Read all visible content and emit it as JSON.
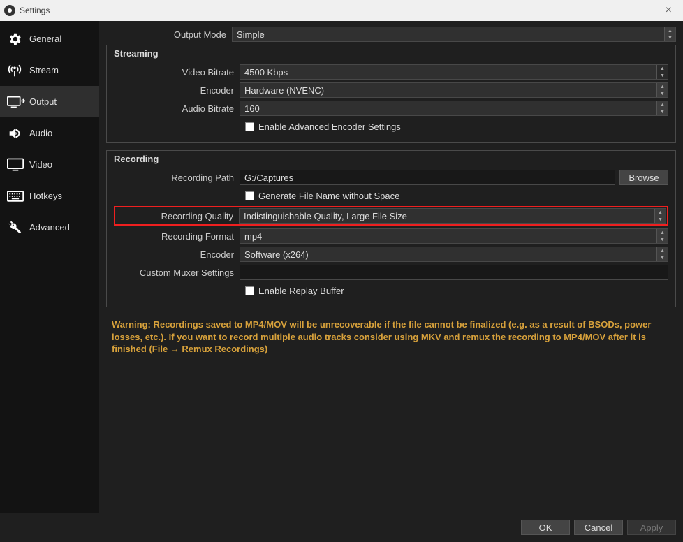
{
  "window": {
    "title": "Settings"
  },
  "sidebar": {
    "items": [
      {
        "label": "General"
      },
      {
        "label": "Stream"
      },
      {
        "label": "Output"
      },
      {
        "label": "Audio"
      },
      {
        "label": "Video"
      },
      {
        "label": "Hotkeys"
      },
      {
        "label": "Advanced"
      }
    ]
  },
  "output_mode": {
    "label": "Output Mode",
    "value": "Simple"
  },
  "streaming": {
    "title": "Streaming",
    "video_bitrate": {
      "label": "Video Bitrate",
      "value": "4500 Kbps"
    },
    "encoder": {
      "label": "Encoder",
      "value": "Hardware (NVENC)"
    },
    "audio_bitrate": {
      "label": "Audio Bitrate",
      "value": "160"
    },
    "adv_cb": {
      "label": "Enable Advanced Encoder Settings"
    }
  },
  "recording": {
    "title": "Recording",
    "path": {
      "label": "Recording Path",
      "value": "G:/Captures",
      "browse": "Browse"
    },
    "gen_cb": {
      "label": "Generate File Name without Space"
    },
    "quality": {
      "label": "Recording Quality",
      "value": "Indistinguishable Quality, Large File Size"
    },
    "format": {
      "label": "Recording Format",
      "value": "mp4"
    },
    "encoder": {
      "label": "Encoder",
      "value": "Software (x264)"
    },
    "muxer": {
      "label": "Custom Muxer Settings",
      "value": ""
    },
    "replay_cb": {
      "label": "Enable Replay Buffer"
    }
  },
  "warning": "Warning: Recordings saved to MP4/MOV will be unrecoverable if the file cannot be finalized (e.g. as a result of BSODs, power losses, etc.). If you want to record multiple audio tracks consider using MKV and remux the recording to MP4/MOV after it is finished (File → Remux Recordings)",
  "footer": {
    "ok": "OK",
    "cancel": "Cancel",
    "apply": "Apply"
  }
}
